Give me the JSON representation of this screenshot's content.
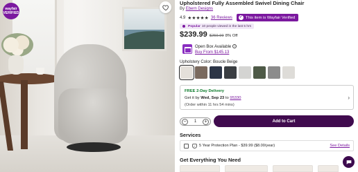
{
  "brand_badge": {
    "line1": "wayfair",
    "line2": "VERIFIED"
  },
  "product": {
    "title": "Upholstered Fully Assembled Swivel Dining Chair",
    "by_prefix": "By",
    "brand": "Ebern Designs",
    "rating": "4.9",
    "stars": "★★★★★",
    "reviews": "36 Reviews",
    "verified_label": "This item is Wayfair Verified"
  },
  "popular": {
    "label": "Popular",
    "text": "10 people viewed in the last 5 hrs"
  },
  "price": {
    "current": "$239.99",
    "original": "$259.99",
    "discount": "8% Off"
  },
  "open_box": {
    "label": "Open Box Available",
    "link": "Buy From $145.13"
  },
  "upholstery": {
    "label": "Upholstery Color:",
    "selected": "Boucle Beige",
    "swatches": [
      "#e4e0da",
      "#7a6a5e",
      "#2c3546",
      "#3a3e42",
      "#d4d4d2",
      "#4e5a47",
      "#8c8c8c",
      "#dedcd8"
    ]
  },
  "delivery": {
    "title": "FREE 2-Day Delivery",
    "date_prefix": "Get it by",
    "date": "Wed, Sep 23",
    "to": "to",
    "zip": "95330",
    "cutoff": "(Order within 11 hrs 54 mins)"
  },
  "quantity": {
    "value": "1",
    "minus": "−",
    "plus": "+"
  },
  "cart_button": "Add to Cart",
  "services": {
    "heading": "Services",
    "plan": "5 Year Protection Plan - $39.99 ($8.00/year)",
    "see_details": "See Details"
  },
  "get_everything": {
    "heading": "Get Everything You Need"
  },
  "colors": {
    "accent": "#7b189f",
    "cart": "#400b4e",
    "delivery_green": "#0b7a2a"
  }
}
